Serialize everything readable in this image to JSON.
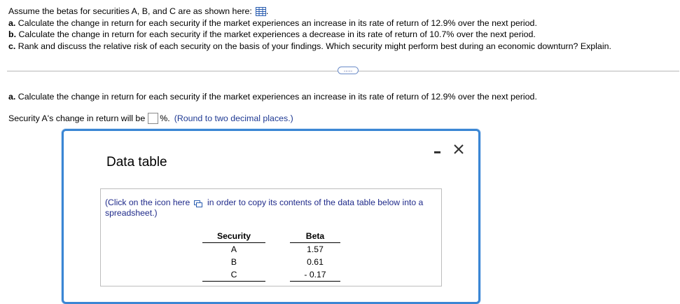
{
  "question": {
    "intro": "Assume the betas for securities A, B, and C are as shown here:",
    "intro_icon": "table-grid-icon",
    "parts": [
      {
        "label": "a.",
        "text": "Calculate the change in return for each security if the market experiences an increase in its rate of return of 12.9% over the next period."
      },
      {
        "label": "b.",
        "text": "Calculate the change in return for each security if the market experiences a decrease in its rate of return of 10.7% over the next period."
      },
      {
        "label": "c.",
        "text": "Rank and discuss the relative risk of each security on the basis of your findings. Which security might perform best during an economic downturn? Explain."
      }
    ]
  },
  "more_button": {
    "label": "....."
  },
  "subquestion": {
    "label": "a.",
    "text": "Calculate the change in return for each security if the market experiences an increase in its rate of return of 12.9% over the next period."
  },
  "answer": {
    "prefix": "Security A's change in return will be",
    "value": "",
    "suffix": "%.",
    "hint": "(Round to two decimal places.)"
  },
  "dialog": {
    "title": "Data table",
    "minimize_icon": "minimize-icon",
    "close_icon": "close-icon",
    "copy_note_before": "(Click on the icon here",
    "copy_note_after": "in order to copy its contents of the data table below into a spreadsheet.)",
    "copy_icon": "copy-icon",
    "table": {
      "headers": [
        "Security",
        "Beta"
      ],
      "rows": [
        {
          "security": "A",
          "beta": "1.57"
        },
        {
          "security": "B",
          "beta": "0.61"
        },
        {
          "security": "C",
          "beta": "- 0.17"
        }
      ]
    }
  },
  "colors": {
    "dialog_border": "#3a86d4",
    "link_text": "#1f3a93",
    "hint_text": "#1f3a93"
  }
}
